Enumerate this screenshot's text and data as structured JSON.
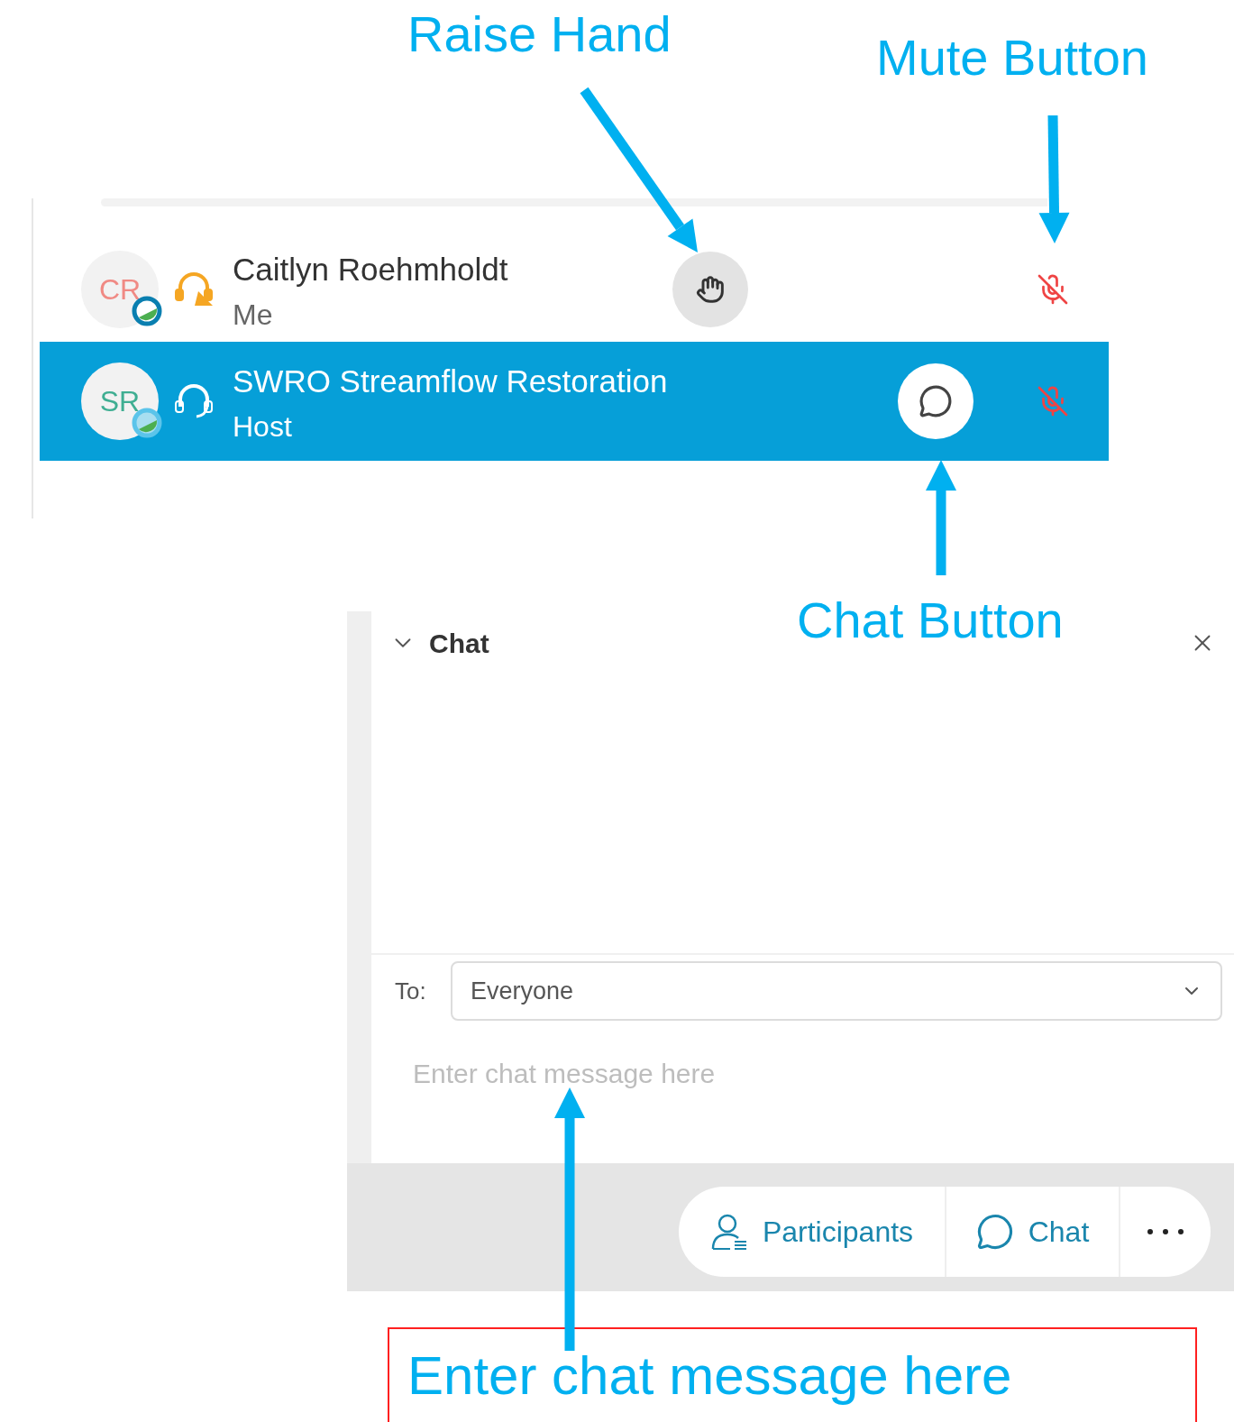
{
  "annotations": [
    {
      "kind": "label",
      "text": "Raise Hand"
    },
    {
      "kind": "label",
      "text": "Mute Button"
    },
    {
      "kind": "label",
      "text": "Chat Button"
    },
    {
      "kind": "box",
      "text": "Enter chat message here"
    }
  ],
  "participants": [
    {
      "initials": "CR",
      "color": "#f08a84",
      "name": "Caitlyn Roehmholdt",
      "role": "Me",
      "audio_active": true,
      "kind": "hand",
      "muted": true,
      "selected": false
    },
    {
      "initials": "SR",
      "color": "#3fae92",
      "name": "SWRO Streamflow Restoration",
      "role": "Host",
      "audio_active": false,
      "kind": "chat",
      "muted": true,
      "selected": true
    }
  ],
  "chat": {
    "title": "Chat",
    "to_label": "To:",
    "recipient": "Everyone",
    "placeholder": "Enter chat message here"
  },
  "toolbar": [
    {
      "kind": "participants",
      "label": "Participants"
    },
    {
      "kind": "chat",
      "label": "Chat"
    },
    {
      "kind": "more"
    }
  ]
}
